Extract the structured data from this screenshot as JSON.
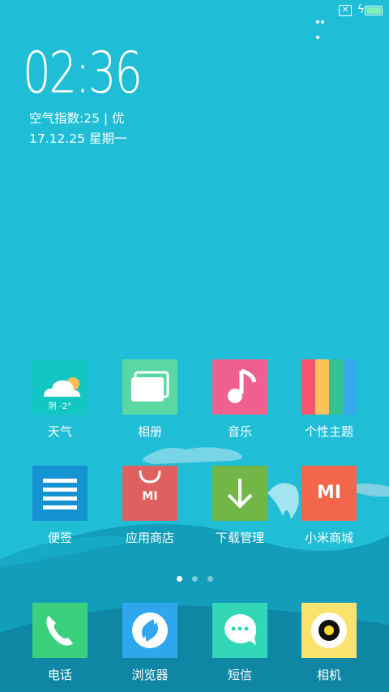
{
  "status_bar": {
    "icons": [
      "more-dots-icon",
      "no-sim-icon",
      "charging-bolt-icon",
      "battery-icon"
    ],
    "battery_color": "#7ff0b8"
  },
  "clock_widget": {
    "time": "02:36",
    "air_quality": "空气指数:25 | 优",
    "date": "17.12.25 星期一"
  },
  "apps": [
    {
      "label": "天气",
      "icon": "weather-icon",
      "tile_text": "阴 -2°",
      "color": "#12c6c4"
    },
    {
      "label": "相册",
      "icon": "gallery-icon",
      "color": "#5bd7a3"
    },
    {
      "label": "音乐",
      "icon": "music-note-icon",
      "color": "#f0608e"
    },
    {
      "label": "个性主题",
      "icon": "themes-stripes-icon",
      "color": "#f4546e"
    },
    {
      "label": "便签",
      "icon": "notes-lines-icon",
      "color": "#1592d2"
    },
    {
      "label": "应用商店",
      "icon": "app-store-bag-icon",
      "tile_text": "MI",
      "color": "#e0605f"
    },
    {
      "label": "下载管理",
      "icon": "download-arrow-icon",
      "color": "#72b648"
    },
    {
      "label": "小米商城",
      "icon": "mi-logo-icon",
      "tile_text": "MI",
      "color": "#f2664b"
    }
  ],
  "page_indicator": {
    "pages": 3,
    "current": 1
  },
  "dock": [
    {
      "label": "电话",
      "icon": "phone-icon",
      "color": "#3ad07c"
    },
    {
      "label": "浏览器",
      "icon": "browser-icon",
      "color": "#2ea7ee"
    },
    {
      "label": "短信",
      "icon": "messages-icon",
      "color": "#30d6b6"
    },
    {
      "label": "相机",
      "icon": "camera-icon",
      "color": "#fbe26e"
    }
  ]
}
